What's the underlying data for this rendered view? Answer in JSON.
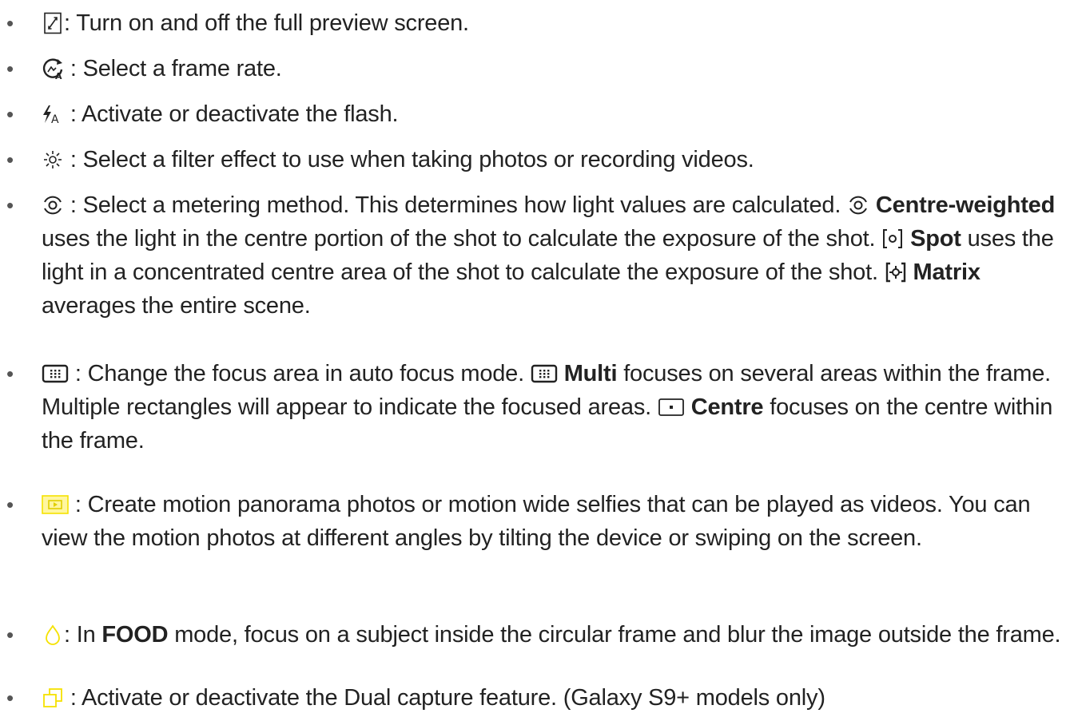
{
  "colors": {
    "text": "#222222",
    "icon_dark": "#222222",
    "icon_yellow": "#f5e200"
  },
  "items": [
    {
      "icon": "full-preview-icon",
      "text": ": Turn on and off the full preview screen."
    },
    {
      "icon": "frame-rate-icon",
      "text": ": Select a frame rate."
    },
    {
      "icon": "flash-auto-icon",
      "text": ": Activate or deactivate the flash."
    },
    {
      "icon": "filter-icon",
      "text": ": Select a filter effect to use when taking photos or recording videos."
    },
    {
      "icon": "metering-icon",
      "text_a": ": Select a metering method. This determines how light values are calculated.",
      "icon_b": "centre-weighted-icon",
      "bold_b": "Centre-weighted",
      "text_b": "uses the light in the centre portion of the shot to calculate the exposure of the shot.",
      "icon_c": "spot-icon",
      "bold_c": "Spot",
      "text_c": "uses the light in a concentrated centre area of the shot to calculate the exposure of the shot.",
      "icon_d": "matrix-icon",
      "bold_d": "Matrix",
      "text_d": "averages the entire scene."
    },
    {
      "icon": "focus-area-icon",
      "text_a": ": Change the focus area in auto focus mode.",
      "icon_b": "multi-focus-icon",
      "bold_b": "Multi",
      "text_b": "focuses on several areas within the frame. Multiple rectangles will appear to indicate the focused areas.",
      "icon_c": "centre-focus-icon",
      "bold_c": "Centre",
      "text_c": "focuses on the centre within the frame."
    },
    {
      "icon": "motion-panorama-icon",
      "text": ": Create motion panorama photos or motion wide selfies that can be played as videos. You can view the motion photos at different angles by tilting the device or swiping on the screen."
    },
    {
      "icon": "food-focus-icon",
      "text_a": ": In",
      "bold_a": "FOOD",
      "text_b": "mode, focus on a subject inside the circular frame and blur the image outside the frame."
    },
    {
      "icon": "dual-capture-icon",
      "text": ": Activate or deactivate the Dual capture feature. (Galaxy S9+ models only)"
    }
  ]
}
